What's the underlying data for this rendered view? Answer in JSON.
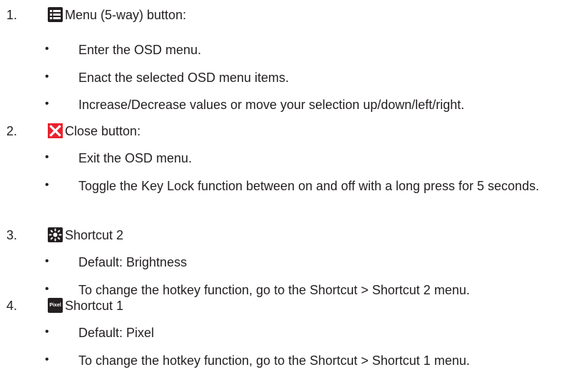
{
  "items": [
    {
      "number": "1.",
      "icon": "menu-list-icon",
      "title": "Menu (5-way) button:",
      "bullets": [
        "Enter the OSD menu.",
        "Enact the selected OSD menu items.",
        "Increase/Decrease values or move your selection up/down/left/right."
      ]
    },
    {
      "number": "2.",
      "icon": "close-x-icon",
      "title": "Close button:",
      "bullets": [
        "Exit the OSD menu.",
        "Toggle the Key Lock function between on and off with a long press for 5 seconds."
      ]
    },
    {
      "number": "3.",
      "icon": "brightness-sun-icon",
      "title": "Shortcut 2",
      "bullets": [
        "Default: Brightness",
        "To change the hotkey function, go to the Shortcut > Shortcut 2 menu."
      ]
    },
    {
      "number": "4.",
      "icon": "pixel-icon",
      "icon_text": "Pixel",
      "title": "Shortcut 1",
      "bullets": [
        "Default: Pixel",
        "To change the hotkey function, go to the Shortcut > Shortcut 1 menu."
      ]
    }
  ],
  "bullet_symbol": "•",
  "colors": {
    "text": "#231f20",
    "close_icon": "#e8232e",
    "icon_dark": "#231f20"
  }
}
